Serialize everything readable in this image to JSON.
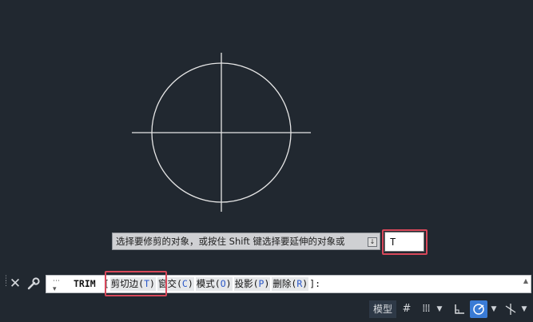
{
  "drawing": {
    "entities": [
      "circle",
      "horizontal-line",
      "vertical-line"
    ]
  },
  "tooltip": {
    "prompt": "选择要修剪的对象，或按住 Shift 键选择要延伸的对象或"
  },
  "dynamic_input": {
    "value": "T"
  },
  "command_line": {
    "command": "TRIM",
    "open_bracket": "[",
    "options": [
      {
        "label": "剪切边",
        "key": "T"
      },
      {
        "label": "窗交",
        "key": "C"
      },
      {
        "label": "模式",
        "key": "O"
      },
      {
        "label": "投影",
        "key": "P"
      },
      {
        "label": "删除",
        "key": "R"
      }
    ],
    "close": "]:"
  },
  "status_bar": {
    "model_tab": "模型"
  },
  "icons": {
    "close": "close-icon",
    "customize": "wrench-icon",
    "grid": "grid-icon",
    "snap": "snap-icon",
    "ortho": "ortho-icon",
    "polar": "polar-icon",
    "isodraft": "isodraft-icon"
  },
  "colors": {
    "canvas": "#212830",
    "geometry": "#e6e6e6",
    "highlight": "#d8485a",
    "option_key": "#2a58c8",
    "active_toggle": "#3a7bd5"
  }
}
